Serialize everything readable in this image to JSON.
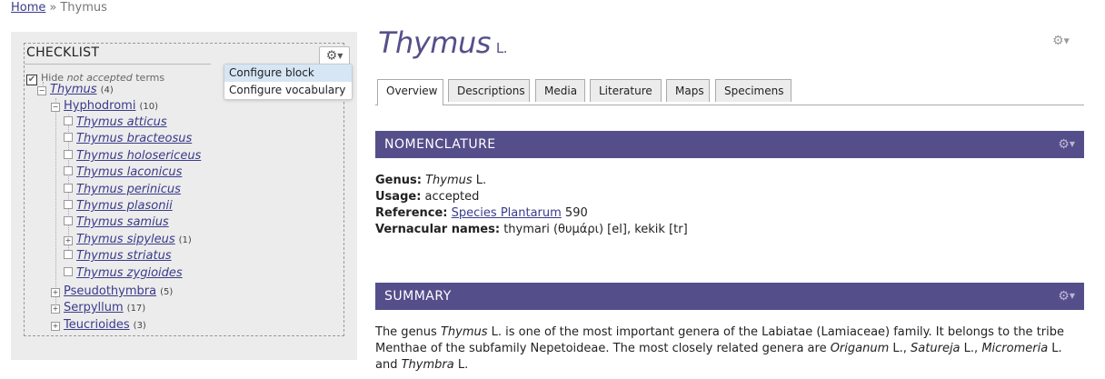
{
  "breadcrumb": {
    "home": "Home",
    "separator": "»",
    "current": "Thymus"
  },
  "sidebar": {
    "checklist_title": "CHECKLIST",
    "cog_icon": "gear-icon",
    "dropdown": [
      "Configure block",
      "Configure vocabulary"
    ],
    "hide_terms": {
      "prefix": "Hide ",
      "em": "not accepted",
      "suffix": " terms",
      "checked": true
    },
    "tree": [
      {
        "label": "Thymus",
        "count": "(4)"
      },
      {
        "label": "Hyphodromi",
        "count": "(10)"
      },
      {
        "label": "Thymus atticus"
      },
      {
        "label": "Thymus bracteosus"
      },
      {
        "label": "Thymus holosericeus"
      },
      {
        "label": "Thymus laconicus"
      },
      {
        "label": "Thymus perinicus"
      },
      {
        "label": "Thymus plasonii"
      },
      {
        "label": "Thymus samius"
      },
      {
        "label": "Thymus sipyleus",
        "count": "(1)"
      },
      {
        "label": "Thymus striatus"
      },
      {
        "label": "Thymus zygioides"
      },
      {
        "label": "Pseudothymbra",
        "count": "(5)"
      },
      {
        "label": "Serpyllum",
        "count": "(17)"
      },
      {
        "label": "Teucrioides",
        "count": "(3)"
      }
    ]
  },
  "page": {
    "title": "Thymus",
    "author": "L."
  },
  "tabs": [
    "Overview",
    "Descriptions",
    "Media",
    "Literature",
    "Maps",
    "Specimens"
  ],
  "nomenclature": {
    "heading": "NOMENCLATURE",
    "genus_label": "Genus:",
    "genus_value": "Thymus",
    "genus_author": " L.",
    "usage_label": "Usage:",
    "usage_value": " accepted",
    "reference_label": "Reference:",
    "reference_link": "Species Plantarum",
    "reference_page": " 590",
    "vernacular_label": "Vernacular names:",
    "vernacular_value": " thymari (θυμάρι) [el], kekik [tr]"
  },
  "summary": {
    "heading": "SUMMARY",
    "p1": "The genus ",
    "p2": "Thymus",
    "p3": " L. is one of the most important genera of the Labiatae (Lamiaceae) family. It belongs to the tribe Menthae of the subfamily Nepetoideae. The most closely related genera are ",
    "g1": "Origanum",
    "g1a": " L., ",
    "g2": "Satureja",
    "g2a": " L., ",
    "g3": "Micromeria",
    "g3a": " L. and ",
    "g4": "Thymbra",
    "g4a": " L."
  },
  "colors": {
    "band": "#544e8b",
    "link": "#3b3b8c",
    "title": "#55508a"
  }
}
